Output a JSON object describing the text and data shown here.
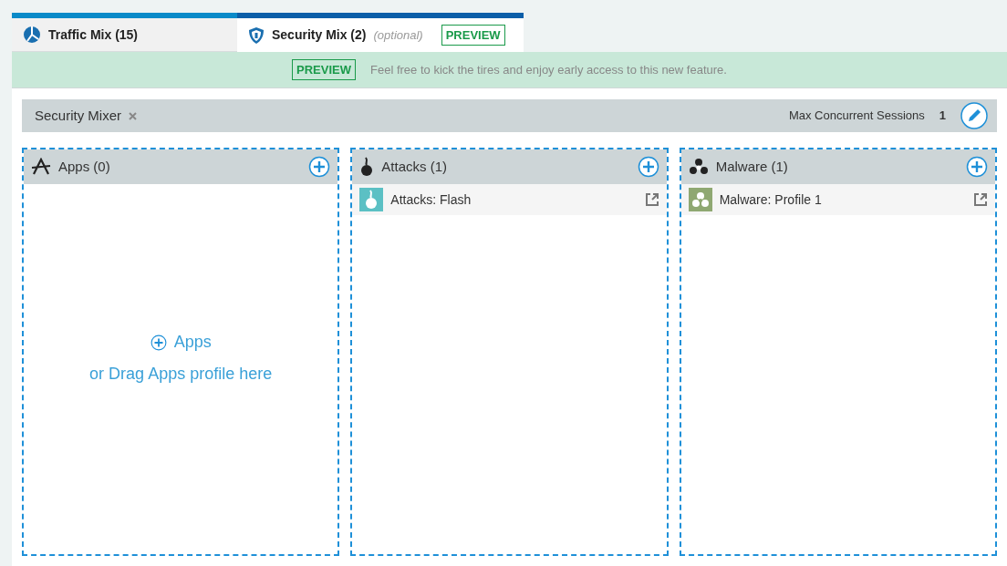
{
  "tabs": [
    {
      "kind": "traffic",
      "label": "Traffic Mix (15)",
      "selected": false
    },
    {
      "kind": "security",
      "label": "Security Mix (2)",
      "note": "(optional)",
      "badge": "PREVIEW",
      "selected": true
    }
  ],
  "banner": {
    "badge": "PREVIEW",
    "text": "Feel free to kick the tires and enjoy early access to this new feature."
  },
  "mixer": {
    "title": "Security Mixer",
    "sessions_label": "Max Concurrent Sessions",
    "sessions_value": "1"
  },
  "columns": [
    {
      "kind": "apps",
      "title": "Apps (0)",
      "empty": {
        "add_label": "Apps",
        "hint": "or Drag Apps profile here"
      }
    },
    {
      "kind": "attacks",
      "title": "Attacks (1)",
      "items": [
        {
          "label": "Attacks: Flash"
        }
      ]
    },
    {
      "kind": "malware",
      "title": "Malware (1)",
      "items": [
        {
          "label": "Malware: Profile 1"
        }
      ]
    }
  ]
}
